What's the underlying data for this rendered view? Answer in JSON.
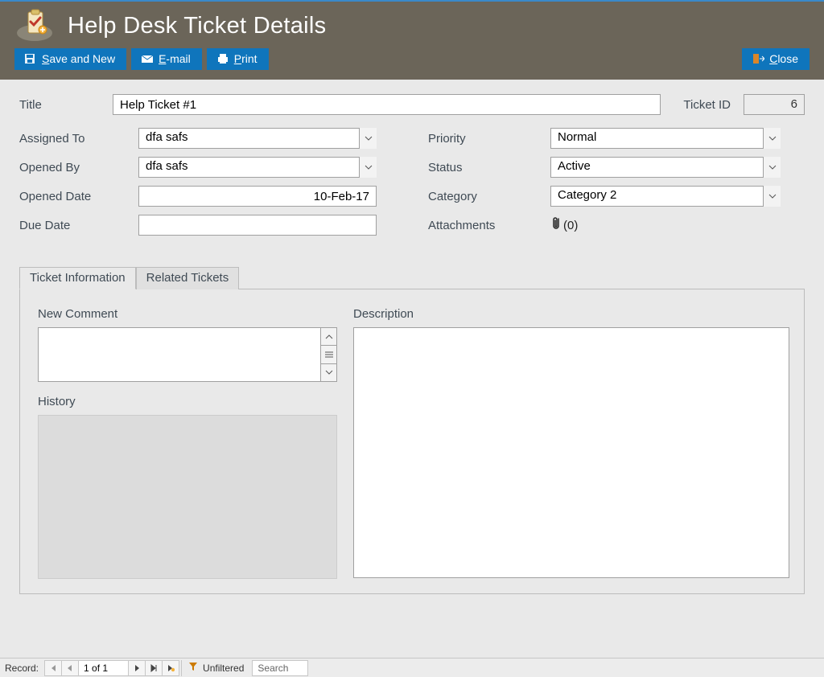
{
  "header": {
    "title": "Help Desk Ticket Details",
    "toolbar": {
      "save_and_new": "Save and New",
      "email": "E-mail",
      "print": "Print",
      "close": "Close"
    }
  },
  "form": {
    "title_label": "Title",
    "title_value": "Help Ticket #1",
    "ticketid_label": "Ticket ID",
    "ticketid_value": "6",
    "left": {
      "assigned_to_label": "Assigned To",
      "assigned_to_value": "dfa safs",
      "opened_by_label": "Opened By",
      "opened_by_value": "dfa safs",
      "opened_date_label": "Opened Date",
      "opened_date_value": "10-Feb-17",
      "due_date_label": "Due Date",
      "due_date_value": ""
    },
    "right": {
      "priority_label": "Priority",
      "priority_value": "Normal",
      "status_label": "Status",
      "status_value": "Active",
      "category_label": "Category",
      "category_value": "Category 2",
      "attachments_label": "Attachments",
      "attachments_count": "(0)"
    }
  },
  "tabs": {
    "ticket_info": "Ticket Information",
    "related": "Related Tickets",
    "new_comment_label": "New Comment",
    "history_label": "History",
    "description_label": "Description"
  },
  "recnav": {
    "label": "Record:",
    "position": "1 of 1",
    "filter": "Unfiltered",
    "search_placeholder": "Search"
  }
}
